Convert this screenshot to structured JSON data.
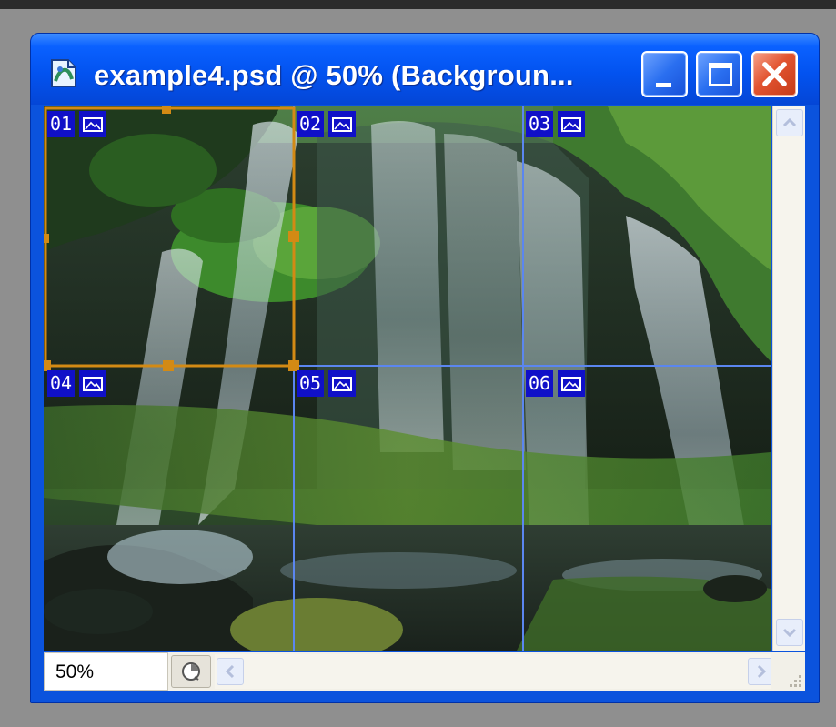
{
  "window": {
    "title": "example4.psd @ 50% (Backgroun...",
    "app_icon": "photoshop-document-icon",
    "buttons": {
      "minimize": "minimize-icon",
      "maximize": "maximize-icon",
      "close": "close-icon"
    }
  },
  "canvas": {
    "image": "waterfall-photo",
    "slices": [
      {
        "label": "01",
        "icon": "image-slice-icon",
        "selected": true
      },
      {
        "label": "02",
        "icon": "image-slice-icon",
        "selected": false
      },
      {
        "label": "03",
        "icon": "image-slice-icon",
        "selected": false
      },
      {
        "label": "04",
        "icon": "image-slice-icon",
        "selected": false
      },
      {
        "label": "05",
        "icon": "image-slice-icon",
        "selected": false
      },
      {
        "label": "06",
        "icon": "image-slice-icon",
        "selected": false
      }
    ]
  },
  "status": {
    "zoom": "50%",
    "nav_icon": "navigator-icon"
  },
  "colors": {
    "titlebar": "#0a5cf0",
    "slice_label_bg": "#1010c8",
    "selected_slice_border": "#d38a14",
    "slice_line": "#5b86f0",
    "close_button": "#e25430"
  }
}
